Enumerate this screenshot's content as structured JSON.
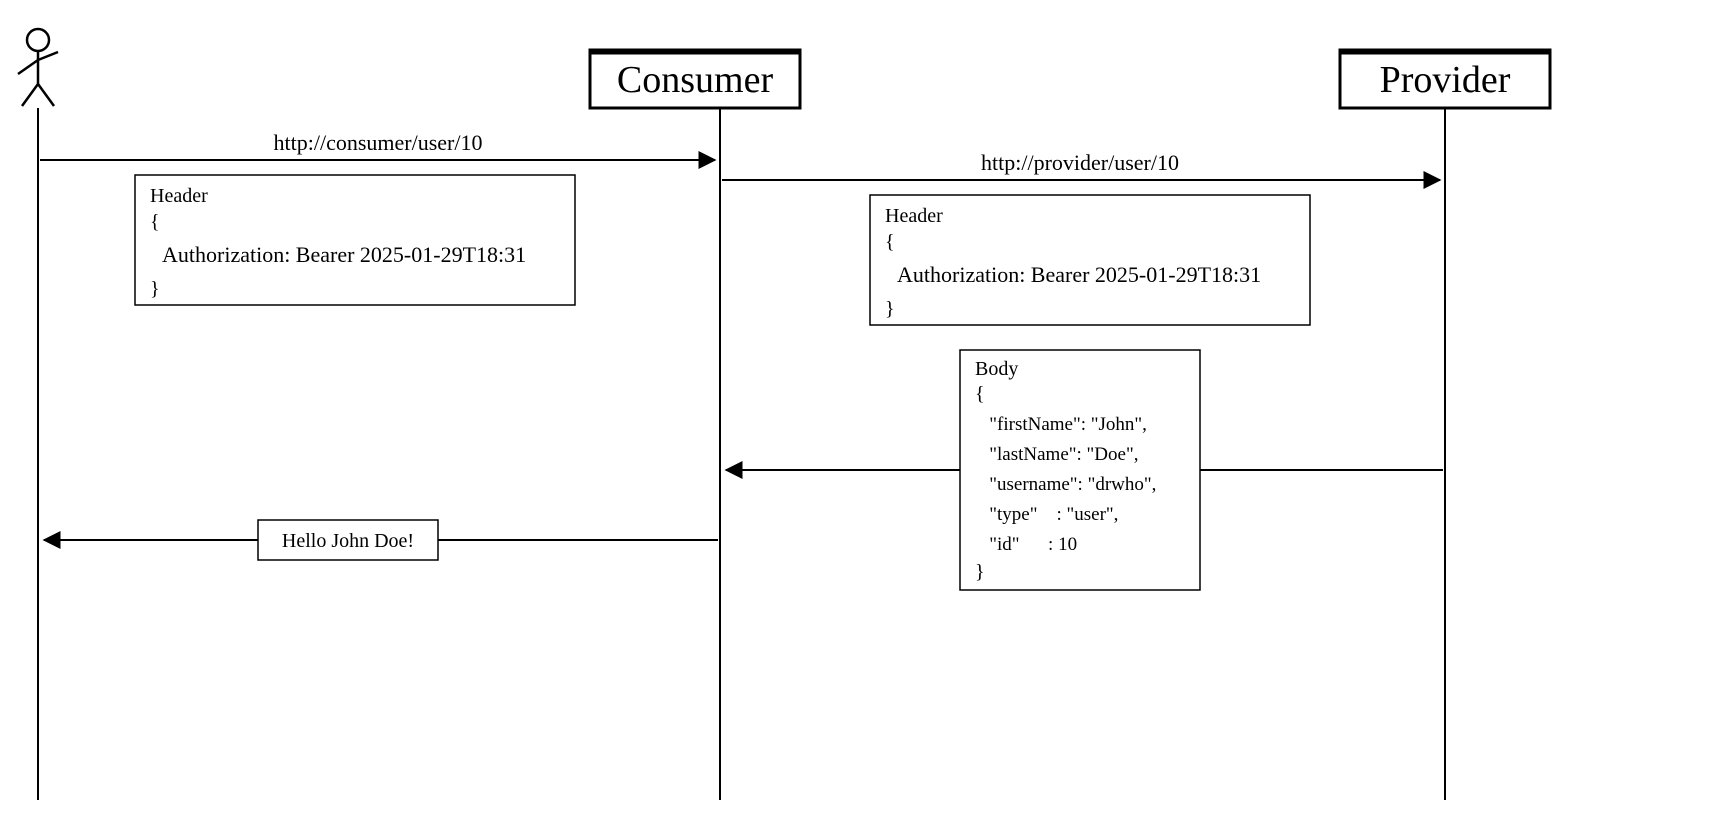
{
  "participants": {
    "actor": "User",
    "consumer": "Consumer",
    "provider": "Provider"
  },
  "messages": {
    "req_consumer": "http://consumer/user/10",
    "req_provider": "http://provider/user/10",
    "resp_user": "Hello John Doe!"
  },
  "header_box": {
    "title": "Header",
    "open": "{",
    "line": "Authorization: Bearer 2025-01-29T18:31",
    "close": "}"
  },
  "body_box": {
    "title": "Body",
    "open": "{",
    "l1": "   \"firstName\": \"John\",",
    "l2": "   \"lastName\": \"Doe\",",
    "l3": "   \"username\": \"drwho\",",
    "l4": "   \"type\"    : \"user\",",
    "l5": "   \"id\"      : 10",
    "close": "}"
  }
}
